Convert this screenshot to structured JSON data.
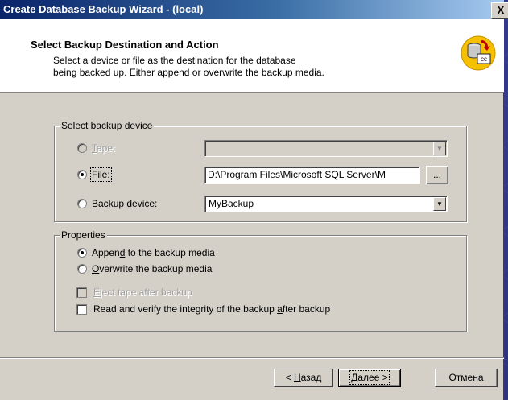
{
  "window": {
    "title": "Create Database Backup Wizard - (local)",
    "close_label": "X"
  },
  "header": {
    "title": "Select Backup Destination and Action",
    "description_line1": "Select a device or file as the destination for the database",
    "description_line2": "being backed up. Either append or overwrite the backup media.",
    "icon": "database-backup-icon"
  },
  "device_group": {
    "legend": "Select backup device",
    "tape": {
      "prefix": "",
      "accel": "T",
      "rest": "ape:",
      "selected": false,
      "enabled": false,
      "value": ""
    },
    "file": {
      "prefix": "",
      "accel": "F",
      "rest": "ile:",
      "selected": true,
      "enabled": true,
      "value": "D:\\Program Files\\Microsoft SQL Server\\M",
      "browse_label": "..."
    },
    "backup_device": {
      "prefix": "Bac",
      "accel": "k",
      "rest": "up device:",
      "selected": false,
      "enabled": true,
      "value": "MyBackup"
    }
  },
  "properties_group": {
    "legend": "Properties",
    "append": {
      "prefix": "Appen",
      "accel": "d",
      "rest": " to the backup media",
      "selected": true
    },
    "overwrite": {
      "prefix": "",
      "accel": "O",
      "rest": "verwrite the backup media",
      "selected": false
    },
    "eject": {
      "prefix": "",
      "accel": "E",
      "rest": "ject tape after backup",
      "checked": false,
      "enabled": false
    },
    "verify": {
      "prefix": "Read and verify the integrity of the backup ",
      "accel": "a",
      "rest": "fter backup",
      "checked": false,
      "enabled": true
    }
  },
  "buttons": {
    "back": {
      "prefix": "< ",
      "accel": "Н",
      "rest": "азад"
    },
    "next": {
      "prefix": "",
      "accel": "Д",
      "rest": "алее >"
    },
    "cancel": {
      "label": "Отмена"
    }
  },
  "colors": {
    "dialog_bg": "#d4d0c8",
    "title_start": "#0a246a",
    "title_end": "#a6caf0",
    "desktop": "#3a3f8f"
  }
}
